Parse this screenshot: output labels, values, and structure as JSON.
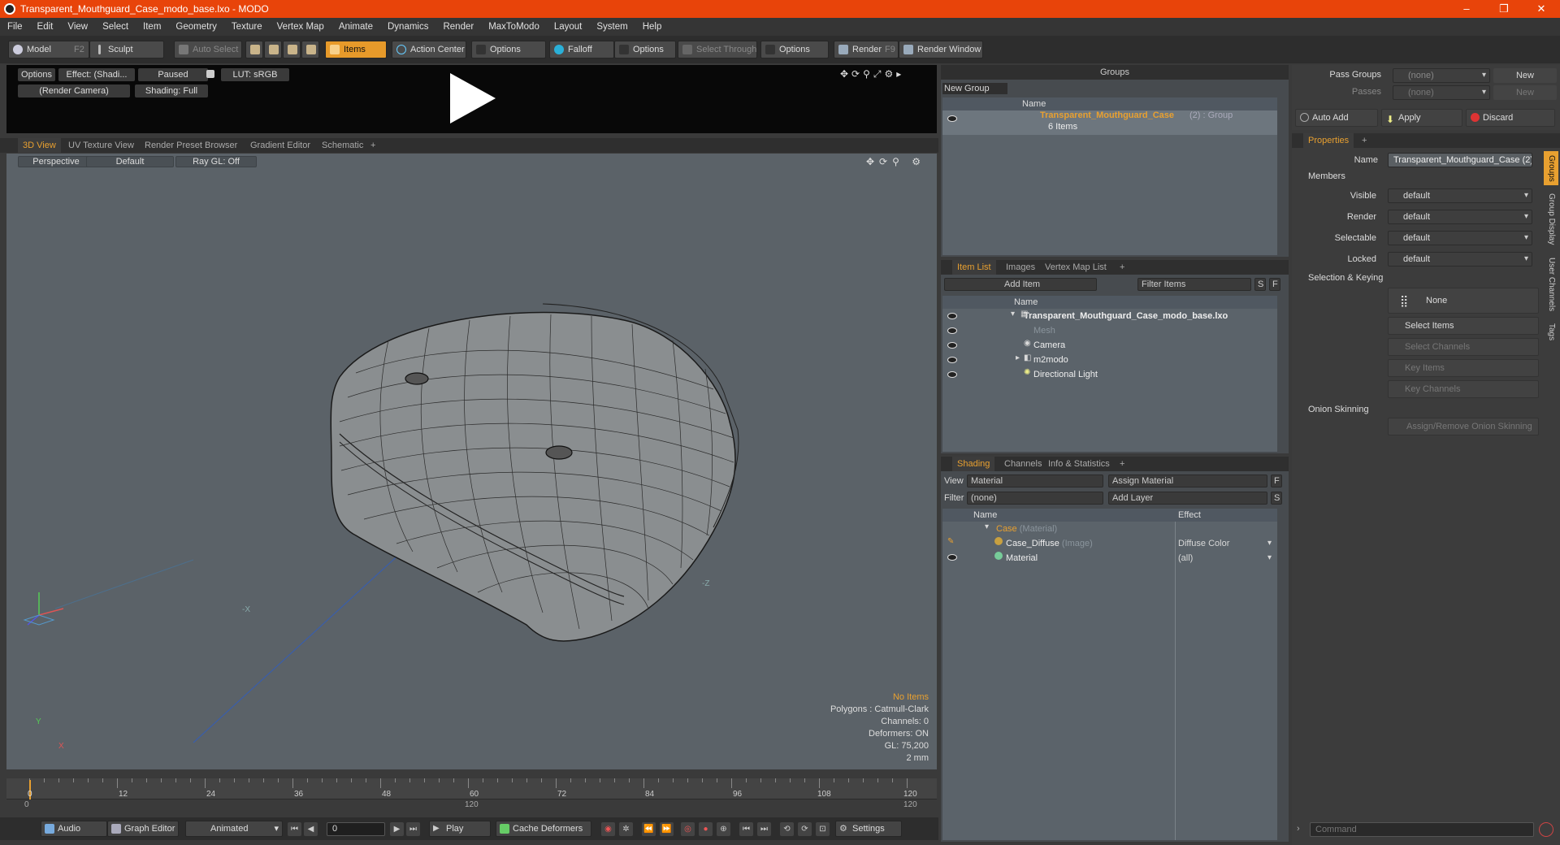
{
  "window": {
    "title": "Transparent_Mouthguard_Case_modo_base.lxo - MODO",
    "minimize": "–",
    "maximize": "❐",
    "close": "✕"
  },
  "menu": [
    "File",
    "Edit",
    "View",
    "Select",
    "Item",
    "Geometry",
    "Texture",
    "Vertex Map",
    "Animate",
    "Dynamics",
    "Render",
    "MaxToModo",
    "Layout",
    "System",
    "Help"
  ],
  "toolbar": {
    "model": "Model",
    "model_key": "F2",
    "sculpt": "Sculpt",
    "auto_select": "Auto Select",
    "items": "Items",
    "action_center": "Action Center",
    "options1": "Options",
    "falloff": "Falloff",
    "options2": "Options",
    "select_through": "Select Through",
    "options3": "Options",
    "render": "Render",
    "render_key": "F9",
    "render_window": "Render Window"
  },
  "render_hud": {
    "options": "Options",
    "effect": "Effect: (Shadi...",
    "paused": "Paused",
    "lut": "LUT: sRGB",
    "camera": "(Render Camera)",
    "shading": "Shading: Full"
  },
  "viewport_tabs": [
    "3D View",
    "UV Texture View",
    "Render Preset Browser",
    "Gradient Editor",
    "Schematic",
    "+"
  ],
  "viewport": {
    "perspective": "Perspective",
    "default": "Default",
    "raygl": "Ray GL: Off",
    "axis_neg_x": "-X",
    "axis_neg_z": "-Z",
    "axis_y": "Y",
    "axis_x": "X",
    "stats": {
      "no_items": "No Items",
      "polygons": "Polygons : Catmull-Clark",
      "channels": "Channels: 0",
      "deformers": "Deformers: ON",
      "gl": "GL: 75,200",
      "scale": "2 mm"
    }
  },
  "timeline": {
    "ticks": [
      "0",
      "12",
      "24",
      "36",
      "48",
      "60",
      "72",
      "84",
      "96",
      "108",
      "120"
    ],
    "sub_ticks": [
      "0",
      "120",
      "120"
    ]
  },
  "bottom": {
    "audio": "Audio",
    "graph_editor": "Graph Editor",
    "animated": "Animated",
    "frame": "0",
    "play": "Play",
    "cache_deformers": "Cache Deformers",
    "settings": "Settings"
  },
  "groups_panel": {
    "title": "Groups",
    "new_group": "New Group",
    "col_name": "Name",
    "item_name": "Transparent_Mouthguard_Case",
    "item_suffix": "(2) : Group",
    "item_count": "6 Items"
  },
  "item_list": {
    "tabs": [
      "Item List",
      "Images",
      "Vertex Map List",
      "+"
    ],
    "add_item": "Add Item",
    "filter_items": "Filter Items",
    "s": "S",
    "f": "F",
    "col_name": "Name",
    "rows": [
      {
        "label": "Transparent_Mouthguard_Case_modo_base.lxo"
      },
      {
        "label": "Mesh"
      },
      {
        "label": "Camera"
      },
      {
        "label": "m2modo"
      },
      {
        "label": "Directional Light"
      }
    ]
  },
  "shading": {
    "tabs": [
      "Shading",
      "Channels",
      "Info & Statistics",
      "+"
    ],
    "view_label": "View",
    "view_value": "Material",
    "assign_material": "Assign Material",
    "filter_label": "Filter",
    "filter_value": "(none)",
    "add_layer": "Add Layer",
    "f": "F",
    "s": "S",
    "col_name": "Name",
    "col_effect": "Effect",
    "rows": [
      {
        "name": "Case",
        "type": "(Material)",
        "effect": ""
      },
      {
        "name": "Case_Diffuse",
        "type": "(Image)",
        "effect": "Diffuse Color"
      },
      {
        "name": "Material",
        "type": "",
        "effect": "(all)"
      }
    ]
  },
  "pass_groups": {
    "pass_groups_label": "Pass Groups",
    "pass_groups_value": "(none)",
    "passes_label": "Passes",
    "passes_value": "(none)",
    "new1": "New",
    "new2": "New",
    "auto_add": "Auto Add",
    "apply": "Apply",
    "discard": "Discard"
  },
  "properties": {
    "tab": "Properties",
    "plus": "+",
    "name_label": "Name",
    "name_value": "Transparent_Mouthguard_Case (2)",
    "members": "Members",
    "visible_label": "Visible",
    "visible_value": "default",
    "render_label": "Render",
    "render_value": "default",
    "selectable_label": "Selectable",
    "selectable_value": "default",
    "locked_label": "Locked",
    "locked_value": "default",
    "selection_keying": "Selection & Keying",
    "none": "None",
    "select_items": "Select Items",
    "select_channels": "Select Channels",
    "key_items": "Key Items",
    "key_channels": "Key Channels",
    "onion_skinning": "Onion Skinning",
    "assign_remove": "Assign/Remove Onion Skinning",
    "side_tabs": [
      "Groups",
      "Group Display",
      "User Channels",
      "Tags"
    ],
    "command_placeholder": "Command"
  },
  "colors": {
    "accent": "#e8a030",
    "titlebar": "#e8440a"
  }
}
